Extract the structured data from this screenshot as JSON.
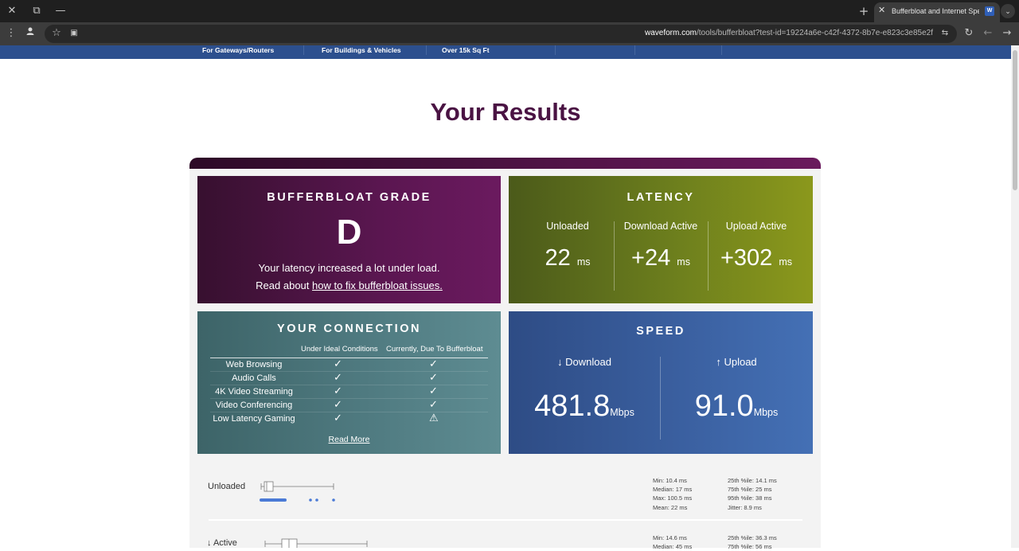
{
  "browser": {
    "tab_title": "Bufferbloat and Internet Speed",
    "tab_favicon": "W",
    "url_host": "waveform.com",
    "url_path": "/tools/bufferbloat?test-id=19224a6e-c42f-4372-8b7e-e823c3e85e2f",
    "icons": [
      "close-icon",
      "restore-icon",
      "minimize-icon",
      "new-tab-icon",
      "more-vert-icon",
      "profile-icon",
      "star-icon",
      "extension-icon",
      "site-settings-icon",
      "reload-icon",
      "back-icon",
      "forward-icon"
    ]
  },
  "nav": {
    "items": [
      "For Gateways/Routers",
      "For Buildings & Vehicles",
      "Over 15k Sq Ft"
    ]
  },
  "page_title": "Your Results",
  "bufferbloat": {
    "heading": "BUFFERBLOAT GRADE",
    "grade": "D",
    "message": "Your latency increased a lot under load.",
    "read_prefix": "Read about ",
    "read_link": "how to fix bufferbloat issues."
  },
  "latency": {
    "heading": "LATENCY",
    "columns": [
      {
        "label": "Unloaded",
        "value": "22",
        "unit": "ms"
      },
      {
        "label": "Download Active",
        "value": "+24",
        "unit": "ms"
      },
      {
        "label": "Upload Active",
        "value": "+302",
        "unit": "ms"
      }
    ]
  },
  "connection": {
    "heading": "YOUR CONNECTION",
    "col_ideal": "Under Ideal Conditions",
    "col_current": "Currently, Due To Bufferbloat",
    "rows": [
      {
        "name": "Web Browsing",
        "ideal": "✓",
        "current": "✓"
      },
      {
        "name": "Audio Calls",
        "ideal": "✓",
        "current": "✓"
      },
      {
        "name": "4K Video Streaming",
        "ideal": "✓",
        "current": "✓"
      },
      {
        "name": "Video Conferencing",
        "ideal": "✓",
        "current": "✓"
      },
      {
        "name": "Low Latency Gaming",
        "ideal": "✓",
        "current": "⚠"
      }
    ],
    "read_more": "Read More"
  },
  "speed": {
    "heading": "SPEED",
    "download_label": "↓ Download",
    "download_value": "481.8",
    "upload_label": "↑ Upload",
    "upload_value": "91.0",
    "unit": "Mbps"
  },
  "unloaded": {
    "label": "Unloaded",
    "min": "Min: 10.4 ms",
    "median": "Median: 17 ms",
    "max": "Max: 100.5 ms",
    "mean": "Mean: 22 ms",
    "p25": "25th %ile: 14.1 ms",
    "p75": "75th %ile: 25 ms",
    "p95": "95th %ile: 38 ms",
    "jitter": "Jitter: 8.9 ms"
  },
  "active": {
    "label": "↓ Active",
    "min": "Min: 14.6 ms",
    "median": "Median: 45 ms",
    "p25": "25th %ile: 36.3 ms",
    "p75": "75th %ile: 56 ms"
  }
}
